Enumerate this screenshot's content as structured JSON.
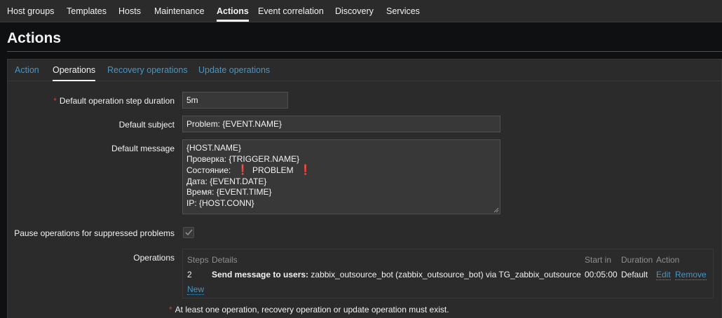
{
  "topnav": {
    "items": [
      {
        "label": "Host groups"
      },
      {
        "label": "Templates"
      },
      {
        "label": "Hosts"
      },
      {
        "label": "Maintenance"
      },
      {
        "label": "Actions",
        "active": true
      },
      {
        "label": "Event correlation"
      },
      {
        "label": "Discovery"
      },
      {
        "label": "Services"
      }
    ]
  },
  "page": {
    "title": "Actions"
  },
  "tabs": [
    {
      "label": "Action"
    },
    {
      "label": "Operations",
      "active": true
    },
    {
      "label": "Recovery operations"
    },
    {
      "label": "Update operations"
    }
  ],
  "form": {
    "step_duration": {
      "label": "Default operation step duration",
      "required_mark": "*",
      "value": "5m"
    },
    "subject": {
      "label": "Default subject",
      "value": "Problem: {EVENT.NAME}"
    },
    "message": {
      "label": "Default message",
      "line1": "{HOST.NAME}",
      "line2": "Проверка: {TRIGGER.NAME}",
      "line3_prefix": "Состояние:",
      "line3_mark1": "❗",
      "line3_word": "PROBLEM",
      "line3_mark2": "❗",
      "line4": "Дата: {EVENT.DATE}",
      "line5": "Время: {EVENT.TIME}",
      "line6": "IP: {HOST.CONN}"
    },
    "pause_suppressed": {
      "label": "Pause operations for suppressed problems",
      "checked": true
    },
    "operations": {
      "label": "Operations",
      "headers": {
        "steps": "Steps",
        "details": "Details",
        "start_in": "Start in",
        "duration": "Duration",
        "action": "Action"
      },
      "row": {
        "steps": "2",
        "details_bold": "Send message to users:",
        "details_rest": "zabbix_outsource_bot (zabbix_outsource_bot) via TG_zabbix_outsource",
        "start_in": "00:05:00",
        "duration": "Default",
        "edit": "Edit",
        "remove": "Remove"
      },
      "new_link": "New"
    },
    "footnote": {
      "mark": "*",
      "text": "At least one operation, recovery operation or update operation must exist."
    }
  },
  "colors": {
    "accent": "#4796c4",
    "required": "#e33734",
    "background": "#0e1012",
    "panel": "#2b2b2b"
  }
}
